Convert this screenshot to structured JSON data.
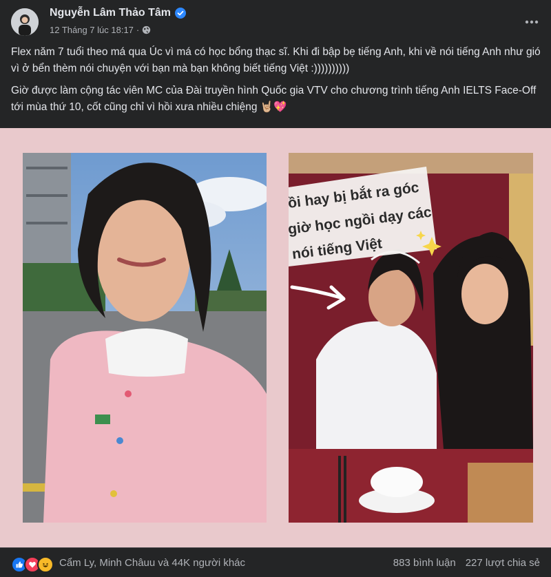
{
  "post": {
    "author": "Nguyễn Lâm Thảo Tâm",
    "timestamp": "12 Tháng 7 lúc 18:17",
    "privacy_icon": "globe-icon",
    "verified_icon": "verified-badge-icon",
    "paragraph_1": "Flex năm 7 tuổi theo má qua Úc vì má có học bổng thạc sĩ. Khi đi bập bẹ tiếng Anh, khi về nói tiếng Anh như gió vì ở bển thèm nói chuyện với bạn mà bạn không biết tiếng Việt :))))))))))",
    "paragraph_2": "Giờ được làm cộng tác viên MC của Đài truyền hình Quốc gia VTV cho chương trình tiếng Anh IELTS Face-Off tới mùa thứ 10, cốt cũng chỉ vì hồi xưa nhiều chiệng 🤘🏼💖",
    "overlay_text": [
      "ồi hay bị bắt ra góc",
      "giờ học ngồi dạy các",
      "nói tiếng Việt"
    ]
  },
  "footer": {
    "reaction_icons": [
      "like-icon",
      "love-icon",
      "haha-icon"
    ],
    "reactors": "Cẩm Ly, Minh Châuu và 44K người khác",
    "comments": "883 bình luận",
    "shares": "227 lượt chia sẻ"
  },
  "colors": {
    "background": "#242526",
    "media_background": "#e9c9cc",
    "verified": "#2d88ff",
    "like": "#1877f2",
    "love": "#f33e58",
    "haha": "#f7b928"
  }
}
